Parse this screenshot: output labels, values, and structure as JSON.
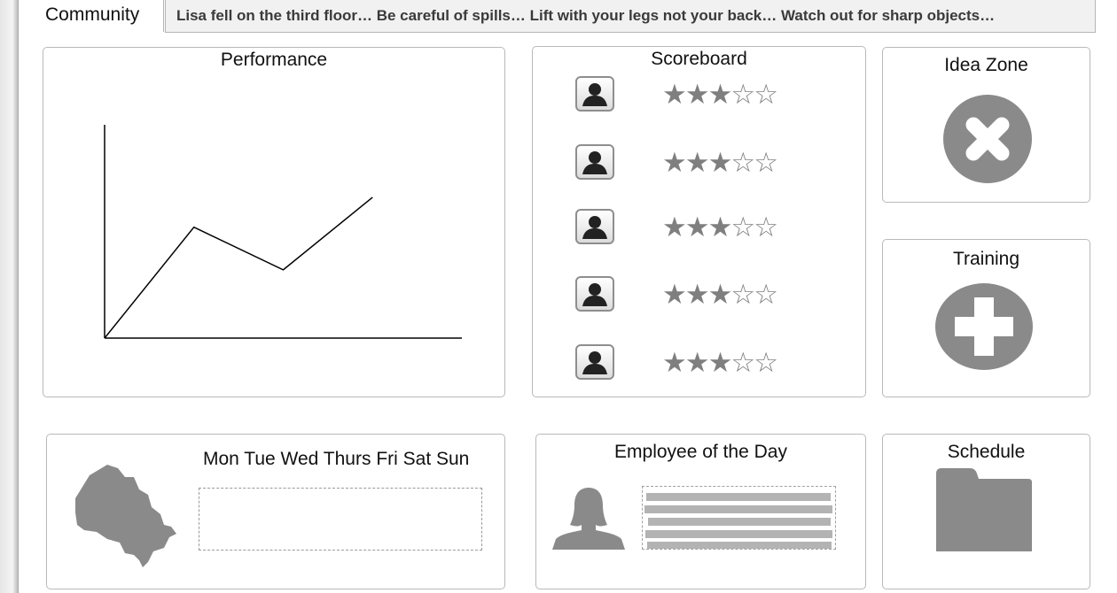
{
  "header": {
    "tab_label": "Community",
    "ticker_text": "Lisa fell on the third floor… Be careful of spills… Lift with your legs not your back… Watch out for sharp objects…"
  },
  "performance": {
    "title": "Performance",
    "chart_data": {
      "type": "line",
      "title": "Performance",
      "x": [
        0,
        1,
        2,
        3
      ],
      "series": [
        {
          "values": [
            0,
            2.6,
            1.6,
            3.3
          ]
        }
      ],
      "xlim": [
        0,
        4
      ],
      "ylim": [
        0,
        5
      ],
      "grid": false
    }
  },
  "scoreboard": {
    "title": "Scoreboard",
    "rows": [
      {
        "rating": 3,
        "max": 5
      },
      {
        "rating": 3,
        "max": 5
      },
      {
        "rating": 3,
        "max": 5
      },
      {
        "rating": 3,
        "max": 5
      },
      {
        "rating": 3,
        "max": 5
      }
    ]
  },
  "idea_zone": {
    "title": "Idea Zone",
    "icon": "close-circle-icon"
  },
  "training": {
    "title": "Training",
    "icon": "plus-circle-icon"
  },
  "calendar": {
    "days_label": "Mon Tue Wed Thurs Fri Sat Sun",
    "map_icon": "ontario-map-icon"
  },
  "employee_of_day": {
    "title": "Employee of the Day",
    "icon": "person-silhouette-icon"
  },
  "schedule": {
    "title": "Schedule",
    "icon": "folder-icon"
  },
  "colors": {
    "icon_gray": "#8a8a8a",
    "border": "#b9b9b9",
    "ticker_bg": "#f1f1f1"
  }
}
